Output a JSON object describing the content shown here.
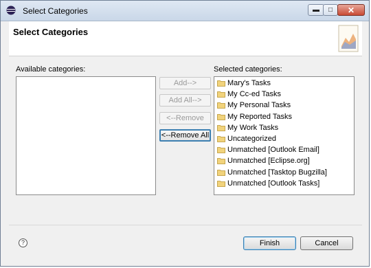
{
  "window": {
    "title": "Select Categories"
  },
  "header": {
    "title": "Select Categories"
  },
  "available": {
    "label": "Available categories:",
    "items": []
  },
  "selected": {
    "label": "Selected categories:",
    "items": [
      "Mary's Tasks",
      "My Cc-ed Tasks",
      "My Personal Tasks",
      "My Reported Tasks",
      "My Work Tasks",
      "Uncategorized",
      "Unmatched [Outlook Email]",
      "Unmatched [Eclipse.org]",
      "Unmatched [Tasktop Bugzilla]",
      "Unmatched [Outlook Tasks]"
    ]
  },
  "actions": {
    "add": "Add-->",
    "add_all": "Add All-->",
    "remove": "<--Remove",
    "remove_all": "<--Remove All"
  },
  "footer": {
    "help": "?",
    "finish": "Finish",
    "cancel": "Cancel"
  }
}
